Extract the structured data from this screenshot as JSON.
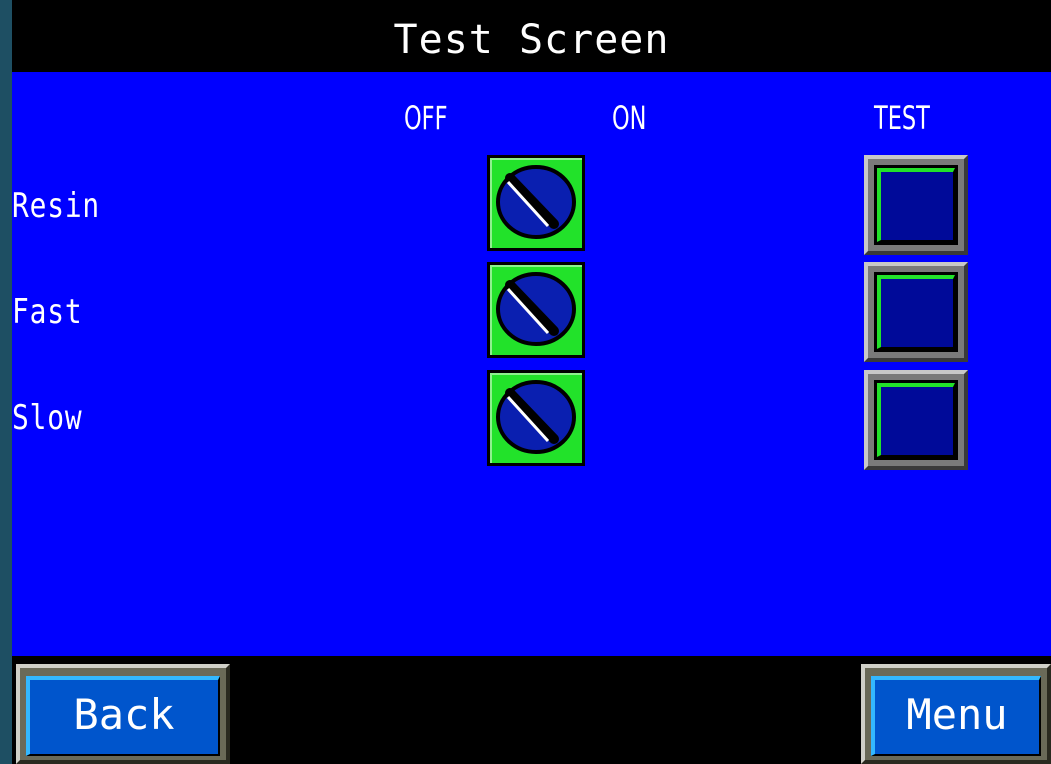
{
  "title": "Test Screen",
  "columns": {
    "off": "OFF",
    "on": "ON",
    "test": "TEST"
  },
  "rows": [
    {
      "label": "Resin",
      "selector": "OFF"
    },
    {
      "label": "Fast",
      "selector": "OFF"
    },
    {
      "label": "Slow",
      "selector": "OFF"
    }
  ],
  "nav": {
    "back": "Back",
    "menu": "Menu"
  },
  "colors": {
    "panel": "#0000ff",
    "selector_bg": "#22e22a",
    "knob": "#0a1fb0",
    "test_face": "#000a99",
    "nav_face": "#0055cc"
  }
}
